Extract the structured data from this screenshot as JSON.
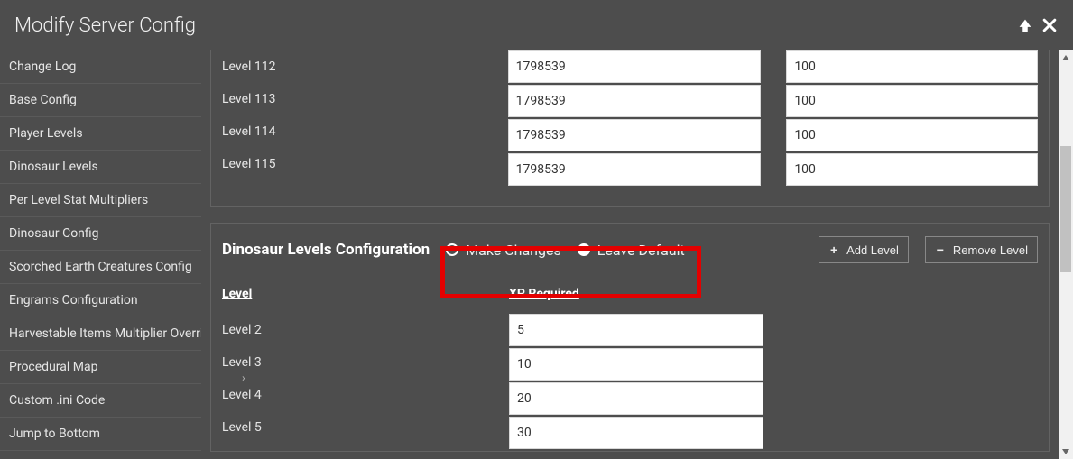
{
  "title": "Modify Server Config",
  "sidebar": [
    "Change Log",
    "Base Config",
    "Player Levels",
    "Dinosaur Levels",
    "Per Level Stat Multipliers",
    "Dinosaur Config",
    "Scorched Earth Creatures Config",
    "Engrams Configuration",
    "Harvestable Items Multiplier Overrides",
    "Procedural Map",
    "Custom .ini Code"
  ],
  "sidebar_footer": "Jump to Bottom",
  "upper": {
    "levels": [
      "Level 112",
      "Level 113",
      "Level 114",
      "Level 115"
    ],
    "xp": [
      "1798539",
      "1798539",
      "1798539",
      "1798539"
    ],
    "pts": [
      "100",
      "100",
      "100",
      "100"
    ]
  },
  "dino": {
    "title": "Dinosaur Levels Configuration",
    "radio_make": "Make Changes",
    "radio_leave": "Leave Default",
    "radio_selected": "leave",
    "add_btn": "Add Level",
    "remove_btn": "Remove Level",
    "col_level": "Level",
    "col_xp": "XP Required",
    "levels": [
      "Level 2",
      "Level 3",
      "Level 4",
      "Level 5"
    ],
    "xp": [
      "5",
      "10",
      "20",
      "30"
    ]
  }
}
